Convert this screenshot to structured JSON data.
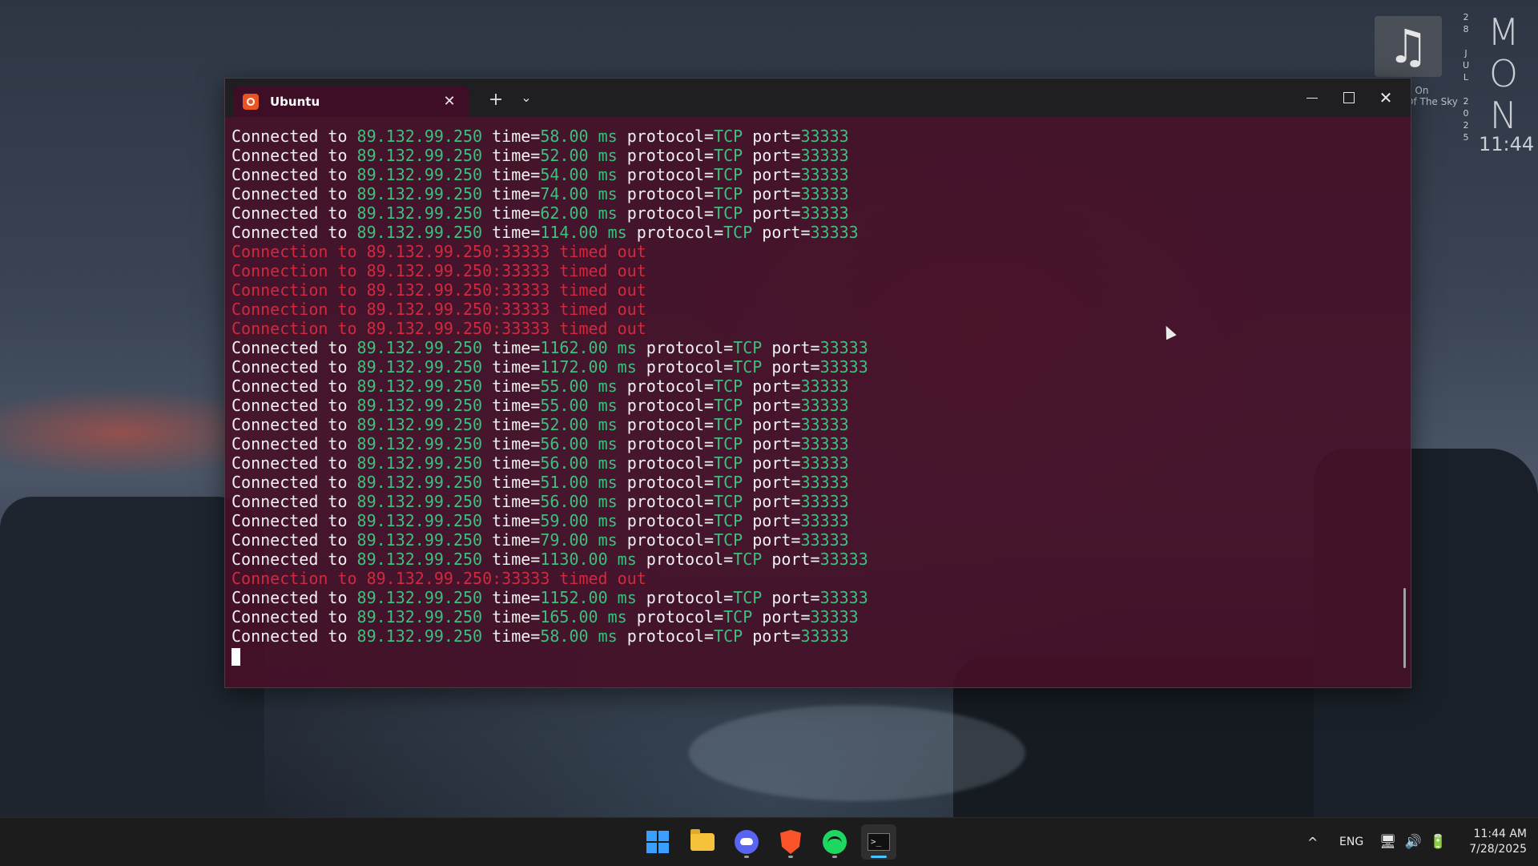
{
  "desktop": {
    "music_widget": {
      "icon": "music-note-icon",
      "song_caption_line1": "d On",
      "song_caption_line2": "Of The Sky"
    },
    "date_vertical": [
      "2",
      "8",
      "",
      "J",
      "U",
      "L",
      "",
      "2",
      "0",
      "2",
      "5"
    ],
    "day_vertical": [
      "M",
      "O",
      "N"
    ],
    "clock": "11:44"
  },
  "window": {
    "tab_title": "Ubuntu",
    "tab_icon": "ubuntu-icon",
    "new_tab_label": "+",
    "dropdown_label": "⌄",
    "close_tab_label": "✕",
    "controls": {
      "minimize": "minimize-icon",
      "maximize": "maximize-icon",
      "close_label": "✕"
    }
  },
  "colors": {
    "success_value": "#3fbf7f",
    "error": "#d02a3e",
    "terminal_bg": "#461028",
    "tab_bg": "#3d0e26"
  },
  "terminal": {
    "ip": "89.132.99.250",
    "port": "33333",
    "protocol": "TCP",
    "prefix": "Connected to",
    "timeout_text": "Connection to 89.132.99.250:33333 timed out",
    "lines": [
      {
        "type": "ok",
        "time": "58.00"
      },
      {
        "type": "ok",
        "time": "52.00"
      },
      {
        "type": "ok",
        "time": "54.00"
      },
      {
        "type": "ok",
        "time": "74.00"
      },
      {
        "type": "ok",
        "time": "62.00"
      },
      {
        "type": "ok",
        "time": "114.00"
      },
      {
        "type": "timeout"
      },
      {
        "type": "timeout"
      },
      {
        "type": "timeout"
      },
      {
        "type": "timeout"
      },
      {
        "type": "timeout"
      },
      {
        "type": "ok",
        "time": "1162.00"
      },
      {
        "type": "ok",
        "time": "1172.00"
      },
      {
        "type": "ok",
        "time": "55.00"
      },
      {
        "type": "ok",
        "time": "55.00"
      },
      {
        "type": "ok",
        "time": "52.00"
      },
      {
        "type": "ok",
        "time": "56.00"
      },
      {
        "type": "ok",
        "time": "56.00"
      },
      {
        "type": "ok",
        "time": "51.00"
      },
      {
        "type": "ok",
        "time": "56.00"
      },
      {
        "type": "ok",
        "time": "59.00"
      },
      {
        "type": "ok",
        "time": "79.00"
      },
      {
        "type": "ok",
        "time": "1130.00"
      },
      {
        "type": "timeout"
      },
      {
        "type": "ok",
        "time": "1152.00"
      },
      {
        "type": "ok",
        "time": "165.00"
      },
      {
        "type": "ok",
        "time": "58.00"
      }
    ]
  },
  "taskbar": {
    "apps": [
      {
        "name": "start",
        "icon": "windows-start-icon"
      },
      {
        "name": "file-explorer",
        "icon": "folder-icon"
      },
      {
        "name": "discord",
        "icon": "discord-icon"
      },
      {
        "name": "brave",
        "icon": "brave-icon"
      },
      {
        "name": "spotify",
        "icon": "spotify-icon"
      },
      {
        "name": "terminal",
        "icon": "terminal-icon",
        "active": true
      }
    ],
    "tray": {
      "chevron": "^",
      "language": "ENG",
      "time": "11:44 AM",
      "date": "7/28/2025"
    }
  }
}
